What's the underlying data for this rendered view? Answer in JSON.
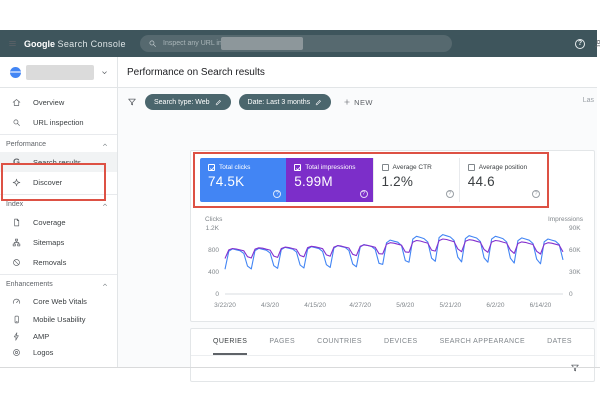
{
  "annotation_color": "#dd5144",
  "header": {
    "brand_bold": "Google",
    "brand_rest": "Search Console",
    "search_placeholder": "Inspect any URL in"
  },
  "sidebar": {
    "sections": [
      {
        "header": null,
        "items": [
          {
            "label": "Overview",
            "icon": "home"
          },
          {
            "label": "URL inspection",
            "icon": "search"
          }
        ]
      },
      {
        "header": "Performance",
        "items": [
          {
            "label": "Search results",
            "icon": "g",
            "selected": true
          },
          {
            "label": "Discover",
            "icon": "discover"
          }
        ]
      },
      {
        "header": "Index",
        "items": [
          {
            "label": "Coverage",
            "icon": "coverage"
          },
          {
            "label": "Sitemaps",
            "icon": "sitemap"
          },
          {
            "label": "Removals",
            "icon": "removals"
          }
        ]
      },
      {
        "header": "Enhancements",
        "items": [
          {
            "label": "Core Web Vitals",
            "icon": "gauge"
          },
          {
            "label": "Mobile Usability",
            "icon": "phone"
          },
          {
            "label": "AMP",
            "icon": "bolt"
          },
          {
            "label": "Logos",
            "icon": "logos"
          }
        ]
      }
    ]
  },
  "main": {
    "title": "Performance on Search results",
    "filters": {
      "chips": [
        {
          "label": "Search type: Web"
        },
        {
          "label": "Date: Last 3 months"
        }
      ],
      "new_label": "NEW",
      "right_truncated": "Las"
    },
    "metric_cards": [
      {
        "label": "Total clicks",
        "value": "74.5K",
        "checked": true,
        "bg": "#4285f4",
        "text": "#ffffff"
      },
      {
        "label": "Total impressions",
        "value": "5.99M",
        "checked": true,
        "bg": "#7c2ec9",
        "text": "#ffffff"
      },
      {
        "label": "Average CTR",
        "value": "1.2%",
        "checked": false,
        "bg": "#ffffff",
        "text": "#3c4043"
      },
      {
        "label": "Average position",
        "value": "44.6",
        "checked": false,
        "bg": "#ffffff",
        "text": "#3c4043"
      }
    ],
    "tabs": {
      "labels": [
        "QUERIES",
        "PAGES",
        "COUNTRIES",
        "DEVICES",
        "SEARCH APPEARANCE",
        "DATES"
      ],
      "active_index": 0
    }
  },
  "chart_data": {
    "type": "line",
    "left_axis": {
      "label": "Clicks",
      "ticks": [
        "1.2K",
        "800",
        "400",
        "0"
      ],
      "max_value": 1200
    },
    "right_axis": {
      "label": "Impressions",
      "ticks": [
        "90K",
        "60K",
        "30K",
        "0"
      ],
      "max_value": 90,
      "unit": "K"
    },
    "x_tick_labels": [
      "3/22/20",
      "4/3/20",
      "4/15/20",
      "4/27/20",
      "5/9/20",
      "5/21/20",
      "6/2/20",
      "6/14/20"
    ],
    "x_tick_days": [
      0,
      12,
      24,
      36,
      48,
      60,
      72,
      84
    ],
    "grid": "baseline-only",
    "series": [
      {
        "name": "Total clicks",
        "axis": "left",
        "color": "#4285f4",
        "values": [
          451,
          779,
          820,
          804,
          787,
          738,
          508,
          457,
          789,
          830,
          813,
          797,
          747,
          515,
          468,
          808,
          850,
          833,
          816,
          765,
          527,
          473,
          817,
          860,
          843,
          826,
          774,
          533,
          484,
          836,
          880,
          862,
          845,
          792,
          546,
          495,
          855,
          900,
          882,
          864,
          810,
          558,
          539,
          931,
          980,
          960,
          941,
          882,
          608,
          578,
          998,
          1050,
          1029,
          1008,
          945,
          651,
          594,
          1026,
          1080,
          1058,
          1037,
          972,
          670,
          583,
          1007,
          1060,
          1039,
          1018,
          954,
          657,
          578,
          998,
          1050,
          1029,
          1008,
          945,
          651,
          561,
          969,
          1020,
          1000,
          979,
          918,
          632,
          550,
          950,
          1000,
          980,
          960,
          900,
          620
        ]
      },
      {
        "name": "Total impressions",
        "axis": "right",
        "color": "#8430ce",
        "values": [
          48.4,
          60.1,
          62,
          61.4,
          60.1,
          58.9,
          50.8,
          49.1,
          61.1,
          63,
          62.4,
          61.1,
          59.9,
          51.7,
          49.9,
          62.1,
          64,
          63.4,
          62.1,
          60.8,
          52.5,
          50.7,
          63.1,
          65,
          64.4,
          63.1,
          61.8,
          53.3,
          51.5,
          64,
          66,
          65.3,
          64,
          62.7,
          54.1,
          52.3,
          65,
          67,
          66.3,
          65,
          63.7,
          54.9,
          54.6,
          67.9,
          70,
          69.3,
          67.9,
          66.5,
          57.4,
          56.9,
          70.8,
          73,
          72.3,
          70.8,
          69.4,
          59.9,
          58.5,
          72.8,
          75,
          74.3,
          72.8,
          71.3,
          61.5,
          57.7,
          71.8,
          74,
          73.3,
          71.8,
          70.3,
          60.7,
          56.9,
          70.8,
          73,
          72.3,
          70.8,
          69.4,
          59.9,
          55.4,
          68.9,
          71,
          70.3,
          68.9,
          67.5,
          58.2,
          54.6,
          67.9,
          70,
          69.3,
          67.9,
          66.5,
          57.4
        ]
      }
    ]
  }
}
